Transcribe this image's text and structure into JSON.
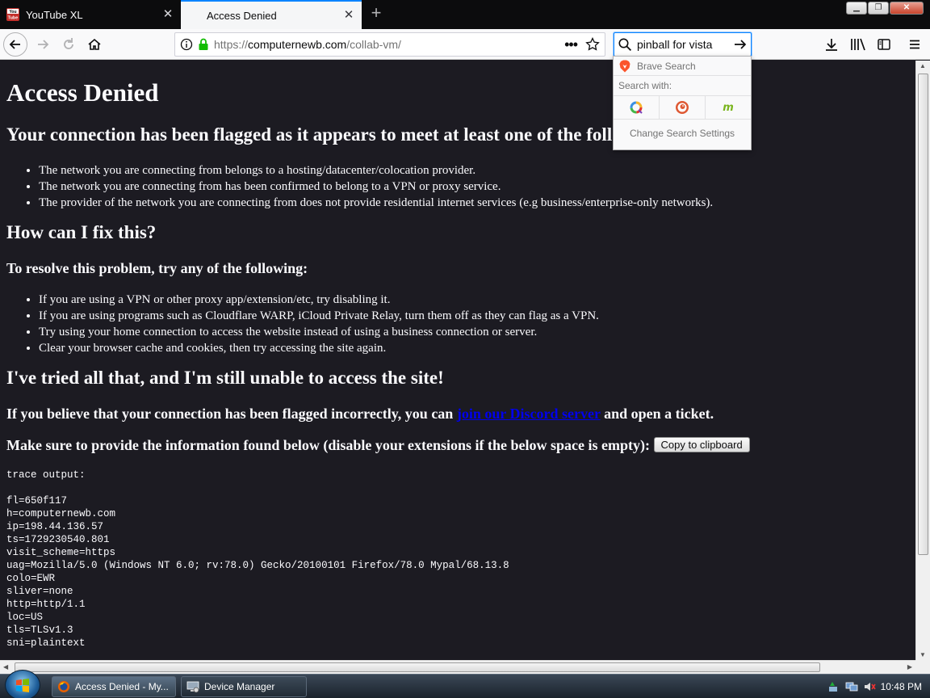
{
  "tabs": [
    {
      "label": "YouTube XL",
      "favicon": "youtube-icon",
      "active": false
    },
    {
      "label": "Access Denied",
      "active": true
    }
  ],
  "nav": {
    "url_prefix": "https://",
    "url_domain": "computernewb.com",
    "url_path": "/collab-vm/",
    "search_value": "pinball for vista"
  },
  "search_popup": {
    "engine": "Brave Search",
    "search_with": "Search with:",
    "settings": "Change Search Settings",
    "engine_icons": [
      "qwant-icon",
      "duckduckgo-icon",
      "mojeek-icon"
    ]
  },
  "page": {
    "title": "Access Denied",
    "flag_heading": "Your connection has been flagged as it appears to meet at least one of the following criteria:",
    "criteria": [
      "The network you are connecting from belongs to a hosting/datacenter/colocation provider.",
      "The network you are connecting from has been confirmed to belong to a VPN or proxy service.",
      "The provider of the network you are connecting from does not provide residential internet services (e.g business/enterprise-only networks)."
    ],
    "fix_heading": "How can I fix this?",
    "resolve_heading": "To resolve this problem, try any of the following:",
    "fixes": [
      "If you are using a VPN or other proxy app/extension/etc, try disabling it.",
      "If you are using programs such as Cloudflare WARP, iCloud Private Relay, turn them off as they can flag as a VPN.",
      "Try using your home connection to access the website instead of using a business connection or server.",
      "Clear your browser cache and cookies, then try accessing the site again."
    ],
    "tried_heading": "I've tried all that, and I'm still unable to access the site!",
    "believe_prefix": "If you believe that your connection has been flagged incorrectly, you can ",
    "discord_link": "join our Discord server",
    "believe_suffix": " and open a ticket.",
    "provide_text": "Make sure to provide the information found below (disable your extensions if the below space is empty): ",
    "copy_button": "Copy to clipboard",
    "trace_label": "trace output:",
    "trace_lines": [
      "fl=650f117",
      "h=computernewb.com",
      "ip=198.44.136.57",
      "ts=1729230540.801",
      "visit_scheme=https",
      "uag=Mozilla/5.0 (Windows NT 6.0; rv:78.0) Gecko/20100101 Firefox/78.0 Mypal/68.13.8",
      "colo=EWR",
      "sliver=none",
      "http=http/1.1",
      "loc=US",
      "tls=TLSv1.3",
      "sni=plaintext"
    ]
  },
  "taskbar": {
    "firefox_task": "Access Denied - My...",
    "devmgr_task": "Device Manager",
    "clock": "10:48 PM"
  },
  "colors": {
    "page_bg": "#1c1b22",
    "link": "#0000ee",
    "accent": "#0a84ff"
  }
}
